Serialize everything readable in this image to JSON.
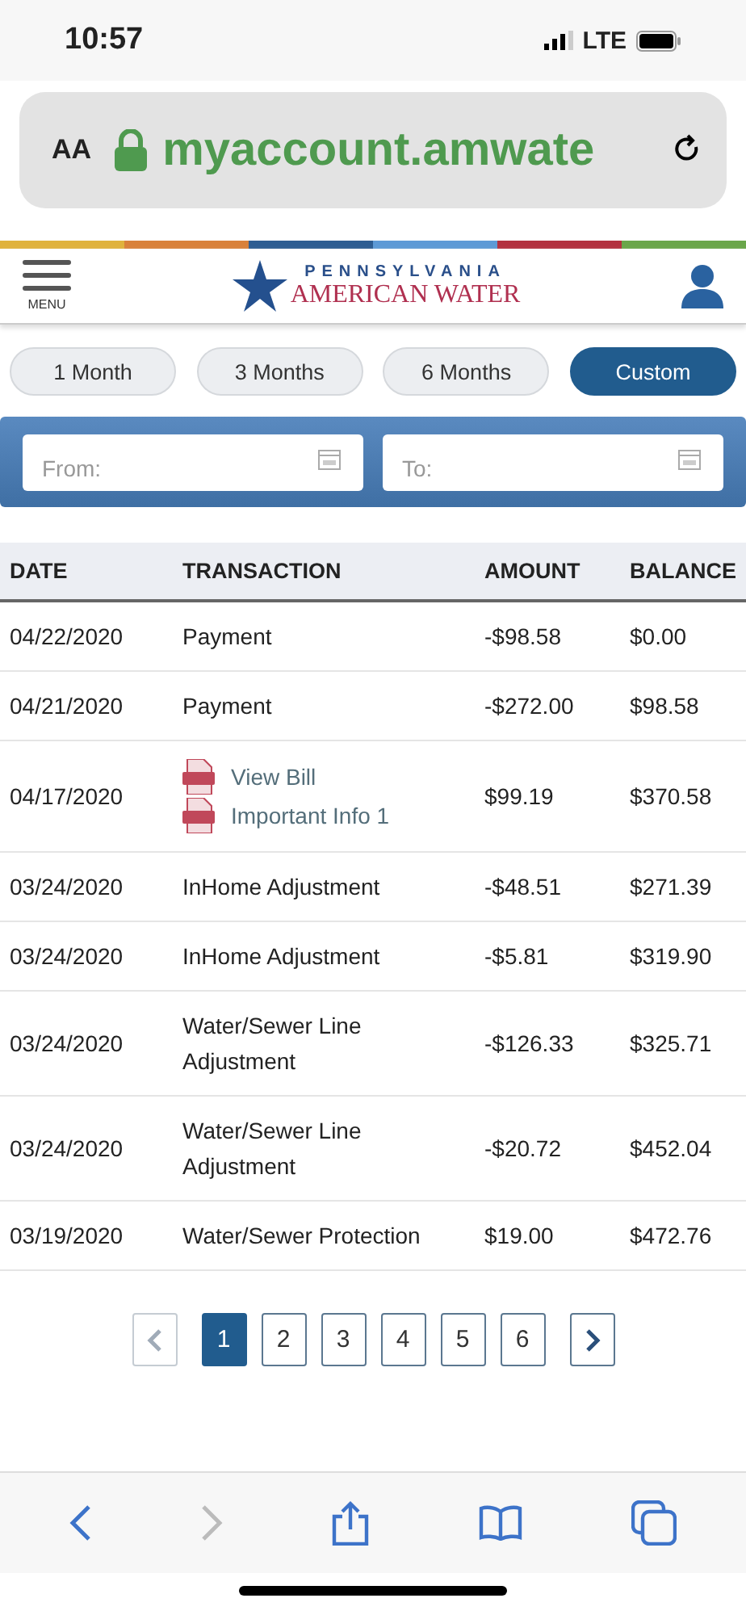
{
  "status_bar": {
    "time": "10:57",
    "network": "LTE"
  },
  "browser": {
    "text_size": "AA",
    "url": "myaccount.amwate"
  },
  "header": {
    "menu_label": "MENU",
    "logo_top": "PENNSYLVANIA",
    "logo_bottom": "AMERICAN WATER"
  },
  "ranges": [
    {
      "label": "1 Month",
      "selected": false
    },
    {
      "label": "3 Months",
      "selected": false
    },
    {
      "label": "6 Months",
      "selected": false
    },
    {
      "label": "Custom",
      "selected": true
    }
  ],
  "date_filter": {
    "from": {
      "placeholder": "From:"
    },
    "to": {
      "placeholder": "To:"
    }
  },
  "table": {
    "columns": [
      "DATE",
      "TRANSACTION",
      "AMOUNT",
      "BALANCE"
    ],
    "rows": [
      {
        "date": "04/22/2020",
        "transaction": {
          "kind": "text",
          "text": "Payment"
        },
        "amount": "-$98.58",
        "balance": "$0.00"
      },
      {
        "date": "04/21/2020",
        "transaction": {
          "kind": "text",
          "text": "Payment"
        },
        "amount": "-$272.00",
        "balance": "$98.58"
      },
      {
        "date": "04/17/2020",
        "transaction": {
          "kind": "links",
          "links": [
            "View Bill",
            "Important Info 1"
          ]
        },
        "amount": "$99.19",
        "balance": "$370.58"
      },
      {
        "date": "03/24/2020",
        "transaction": {
          "kind": "text",
          "text": "InHome Adjustment"
        },
        "amount": "-$48.51",
        "balance": "$271.39"
      },
      {
        "date": "03/24/2020",
        "transaction": {
          "kind": "text",
          "text": "InHome Adjustment"
        },
        "amount": "-$5.81",
        "balance": "$319.90"
      },
      {
        "date": "03/24/2020",
        "transaction": {
          "kind": "text",
          "text": "Water/Sewer Line Adjustment"
        },
        "amount": "-$126.33",
        "balance": "$325.71"
      },
      {
        "date": "03/24/2020",
        "transaction": {
          "kind": "text",
          "text": "Water/Sewer Line Adjustment"
        },
        "amount": "-$20.72",
        "balance": "$452.04"
      },
      {
        "date": "03/19/2020",
        "transaction": {
          "kind": "text",
          "text": "Water/Sewer Protection"
        },
        "amount": "$19.00",
        "balance": "$472.76"
      }
    ]
  },
  "pagination": {
    "prev": {
      "disabled": true
    },
    "next": {
      "disabled": false
    },
    "pages": [
      {
        "label": "1",
        "selected": true
      },
      {
        "label": "2",
        "selected": false
      },
      {
        "label": "3",
        "selected": false
      },
      {
        "label": "4",
        "selected": false
      },
      {
        "label": "5",
        "selected": false
      },
      {
        "label": "6",
        "selected": false
      }
    ]
  },
  "browser_toolbar": {
    "back": {
      "disabled": false
    },
    "forward": {
      "disabled": true
    }
  }
}
